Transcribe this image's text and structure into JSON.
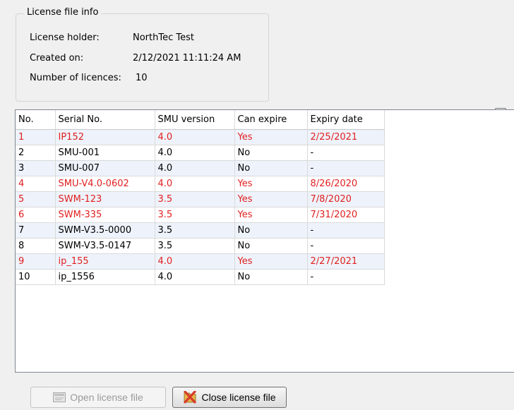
{
  "license_info": {
    "title": "License file info",
    "holder_label": "License holder:",
    "holder_value": "NorthTec Test",
    "created_label": "Created on:",
    "created_value": "2/12/2021 11:11:24 AM",
    "count_label": "Number of licences:",
    "count_value": "10"
  },
  "table": {
    "columns": [
      "No.",
      "Serial No.",
      "SMU version",
      "Can expire",
      "Expiry date"
    ],
    "rows": [
      {
        "no": "1",
        "serial": "IP152",
        "version": "4.0",
        "can_expire": "Yes",
        "expiry": "2/25/2021",
        "expired": true
      },
      {
        "no": "2",
        "serial": "SMU-001",
        "version": "4.0",
        "can_expire": "No",
        "expiry": "-",
        "expired": false
      },
      {
        "no": "3",
        "serial": "SMU-007",
        "version": "4.0",
        "can_expire": "No",
        "expiry": "-",
        "expired": false
      },
      {
        "no": "4",
        "serial": "SMU-V4.0-0602",
        "version": "4.0",
        "can_expire": "Yes",
        "expiry": "8/26/2020",
        "expired": true
      },
      {
        "no": "5",
        "serial": "SWM-123",
        "version": "3.5",
        "can_expire": "Yes",
        "expiry": "7/8/2020",
        "expired": true
      },
      {
        "no": "6",
        "serial": "SWM-335",
        "version": "3.5",
        "can_expire": "Yes",
        "expiry": "7/31/2020",
        "expired": true
      },
      {
        "no": "7",
        "serial": "SWM-V3.5-0000",
        "version": "3.5",
        "can_expire": "No",
        "expiry": "-",
        "expired": false
      },
      {
        "no": "8",
        "serial": "SWM-V3.5-0147",
        "version": "3.5",
        "can_expire": "No",
        "expiry": "-",
        "expired": false
      },
      {
        "no": "9",
        "serial": "ip_155",
        "version": "4.0",
        "can_expire": "Yes",
        "expiry": "2/27/2021",
        "expired": true
      },
      {
        "no": "10",
        "serial": "ip_1556",
        "version": "4.0",
        "can_expire": "No",
        "expiry": "-",
        "expired": false
      }
    ]
  },
  "buttons": {
    "open_label": "Open license file",
    "close_label": "Close license file"
  },
  "colors": {
    "expired_text": "#e02020",
    "close_icon": "#d83b2a"
  }
}
